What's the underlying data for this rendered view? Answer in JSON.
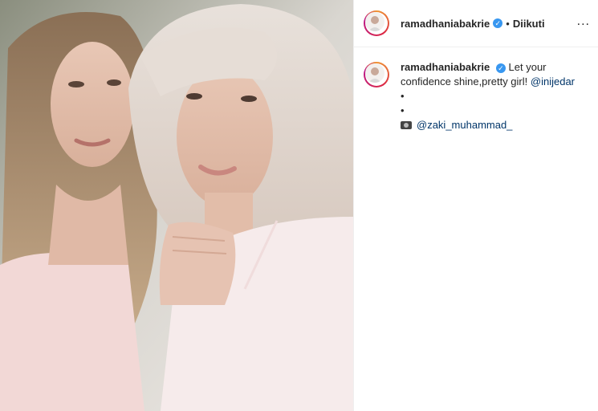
{
  "post": {
    "username": "ramadhaniabakrie",
    "verified": true,
    "follow_status": "Diikuti",
    "dot": "•",
    "more_label": "...",
    "caption": {
      "username": "ramadhaniabakrie",
      "text": "Let your confidence shine,pretty girl!",
      "mention": "@inijedar",
      "bullet1": "•",
      "bullet2": "•",
      "credit_mention": "@zaki_muhammad_"
    }
  },
  "icons": {
    "verified": "verified-badge-icon",
    "more": "more-options-icon",
    "camera": "camera-icon"
  },
  "colors": {
    "verified": "#3897f0",
    "mention": "#003569",
    "border": "#efefef"
  }
}
